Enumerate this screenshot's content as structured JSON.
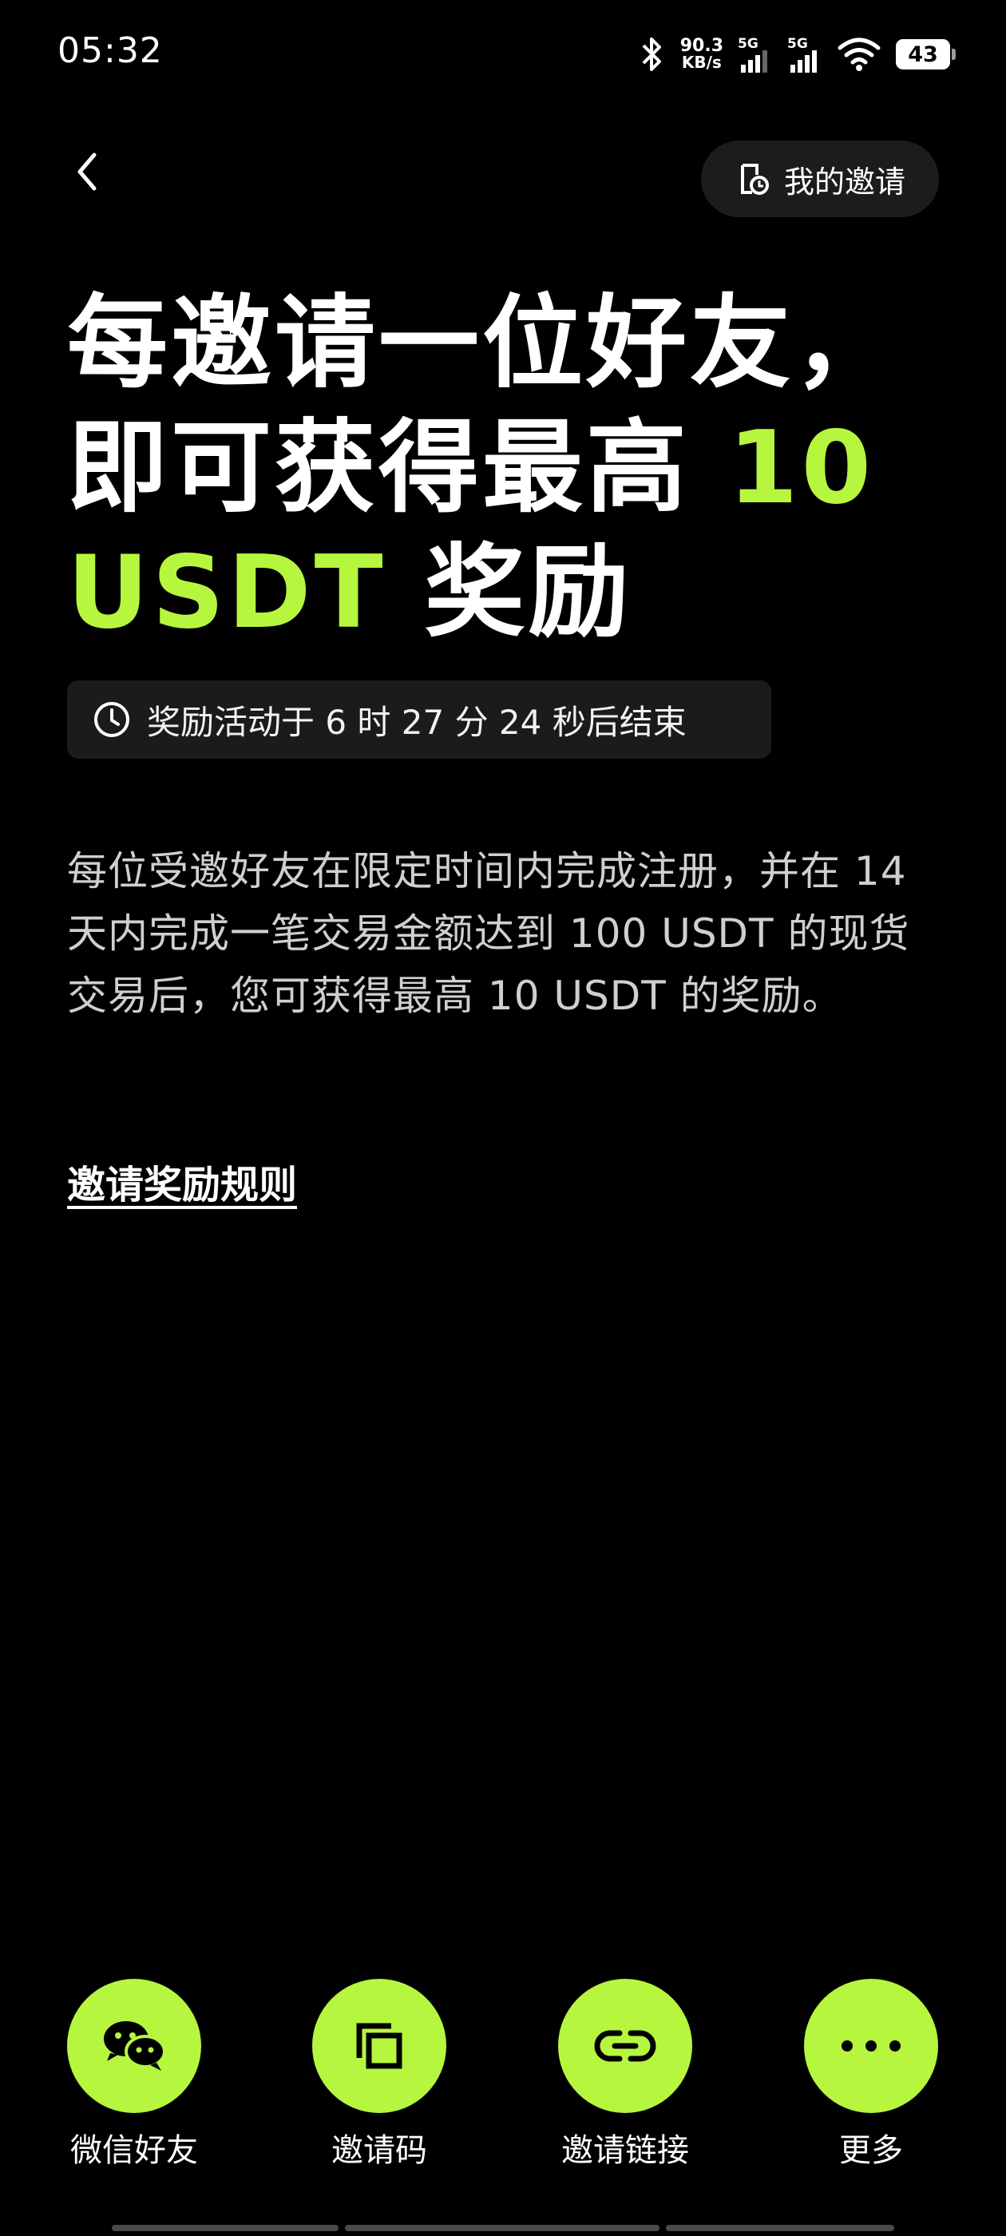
{
  "status_bar": {
    "time": "05:32",
    "net_speed_value": "90.3",
    "net_speed_unit": "KB/s",
    "sim1_label": "5G",
    "sim2_label": "5G",
    "battery_level": "43"
  },
  "header": {
    "back_icon": "chevron-left-icon",
    "my_invites_label": "我的邀请",
    "my_invites_icon": "invite-record-icon"
  },
  "headline": {
    "line1": "每邀请一位好友，",
    "line2_prefix": "即可获得最高 ",
    "line2_accent": "10",
    "line3_accent": "USDT",
    "line3_suffix": " 奖励"
  },
  "countdown": {
    "icon": "clock-icon",
    "text": "奖励活动于 6 时 27 分 24 秒后结束"
  },
  "description": {
    "text": "每位受邀好友在限定时间内完成注册，并在 14 天内完成一笔交易金额达到 100 USDT 的现货交易后，您可获得最高 10 USDT 的奖励。"
  },
  "rules_link": {
    "label": "邀请奖励规则"
  },
  "share_actions": [
    {
      "label": "微信好友",
      "icon": "wechat-icon"
    },
    {
      "label": "邀请码",
      "icon": "copy-icon"
    },
    {
      "label": "邀请链接",
      "icon": "link-icon"
    },
    {
      "label": "更多",
      "icon": "more-dots-icon"
    }
  ],
  "colors": {
    "accent": "#b7f63e",
    "background": "#000000",
    "surface": "#1b1b1b"
  }
}
